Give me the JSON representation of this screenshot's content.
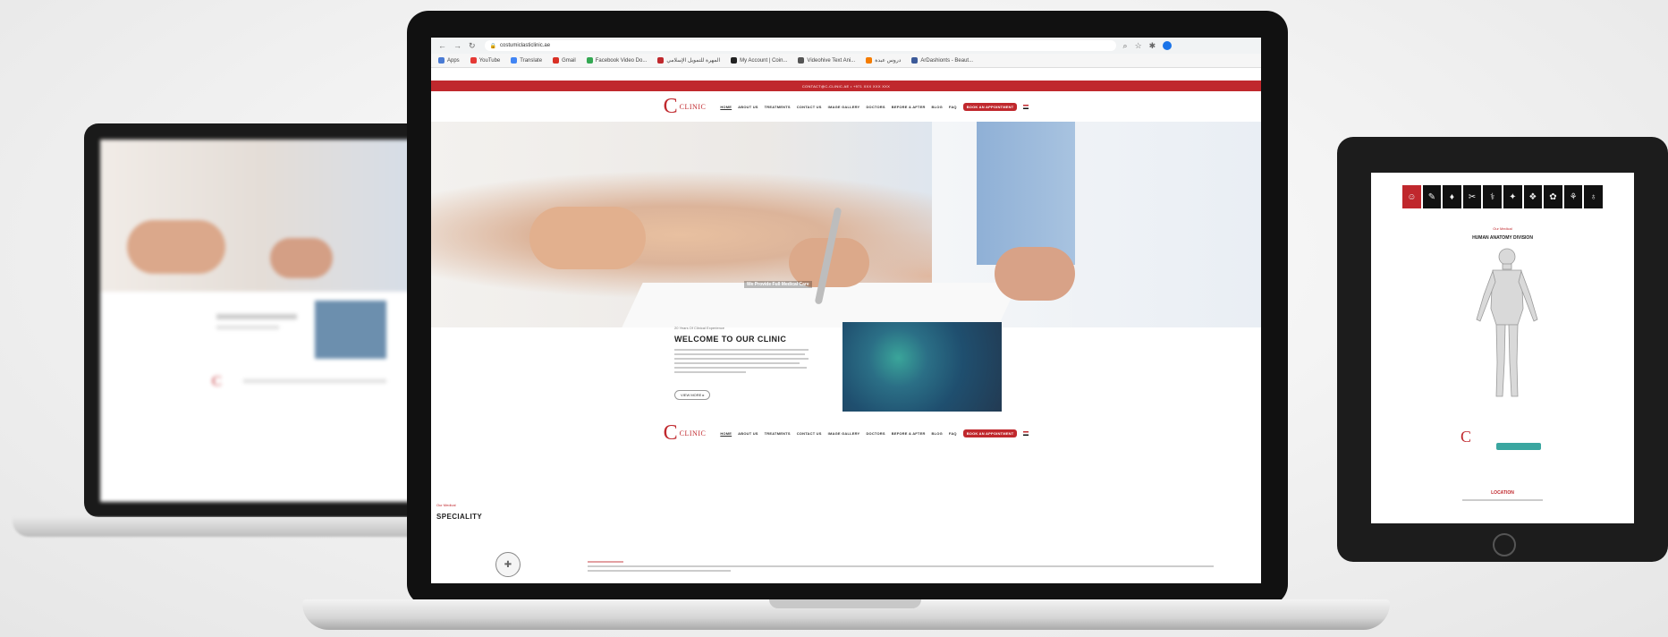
{
  "browser": {
    "url": "costumiclasticlinic.ae",
    "bookmarks": [
      "Apps",
      "YouTube",
      "Translate",
      "Gmail",
      "Facebook Video Do...",
      "المهرة للتمويل الإسلامي",
      "My Account | Coin...",
      "Videohive Text Ani...",
      "دروس عبدة",
      "ArDashionts - Beaut..."
    ],
    "bookmark_colors": [
      "#4a7bd4",
      "#e53935",
      "#4285f4",
      "#d93025",
      "#34a853",
      "#c0282d",
      "#222222",
      "#555555",
      "#f57c00",
      "#3c5a99"
    ]
  },
  "site": {
    "topbar": "CONTACT@C-CLINIC.AE  •  +971 XXX XXX XXX",
    "logo_letter": "C",
    "logo_text": "CLINIC",
    "nav": [
      "HOME",
      "ABOUT US",
      "TREATMENTS",
      "CONTACT US",
      "IMAGE GALLERY",
      "DOCTORS",
      "BEFORE & AFTER",
      "BLOG",
      "FAQ"
    ],
    "appointment": "BOOK AN APPOINTMENT",
    "hero_tagline": "We Provide Full Medical Care",
    "welcome_eyebrow": "20 Years Of Clinical Experience",
    "welcome_title": "WELCOME TO OUR CLINIC",
    "read_more": "VIEW MORE",
    "spec_eyebrow": "Our Medical",
    "spec_title": "SPECIALITY"
  },
  "tablet": {
    "eyebrow": "Our Medical",
    "title": "HUMAN ANATOMY DIVISION",
    "logo_letter": "C",
    "location": "LOCATION"
  },
  "left_laptop": {
    "logo_letter": "C"
  },
  "colors": {
    "brand_red": "#c0282d",
    "accent_teal": "#3aa6a0"
  }
}
